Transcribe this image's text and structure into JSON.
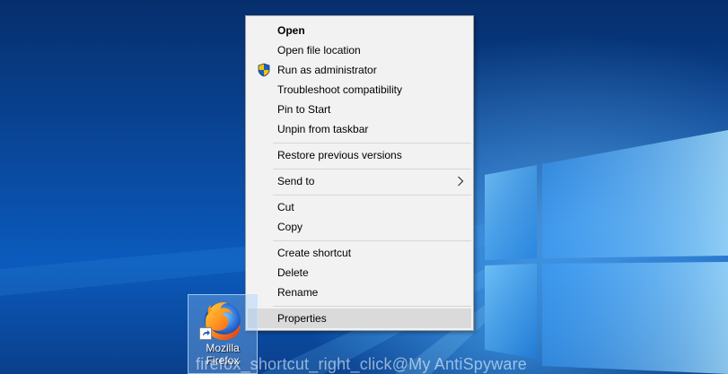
{
  "context_menu": {
    "items": [
      {
        "label": "Open",
        "bold": true
      },
      {
        "label": "Open file location"
      },
      {
        "label": "Run as administrator",
        "icon": "uac-shield-icon"
      },
      {
        "label": "Troubleshoot compatibility"
      },
      {
        "label": "Pin to Start"
      },
      {
        "label": "Unpin from taskbar"
      },
      {
        "label": "Restore previous versions"
      },
      {
        "label": "Send to",
        "submenu_icon": "chevron-right-icon"
      },
      {
        "label": "Cut"
      },
      {
        "label": "Copy"
      },
      {
        "label": "Create shortcut"
      },
      {
        "label": "Delete"
      },
      {
        "label": "Rename"
      },
      {
        "label": "Properties",
        "highlighted": true
      }
    ]
  },
  "desktop_icon": {
    "name_line1": "Mozilla",
    "name_line2": "Firefox",
    "icon": "firefox-icon",
    "overlay_icon": "shortcut-arrow-icon"
  },
  "watermark": "firefox_shortcut_right_click@My AntiSpyware",
  "colors": {
    "menu_background": "#f2f2f2",
    "menu_highlight": "#dadada",
    "desktop_blue": "#0a4aa0",
    "shield_blue": "#1e5fbf",
    "shield_yellow": "#f5c400"
  }
}
